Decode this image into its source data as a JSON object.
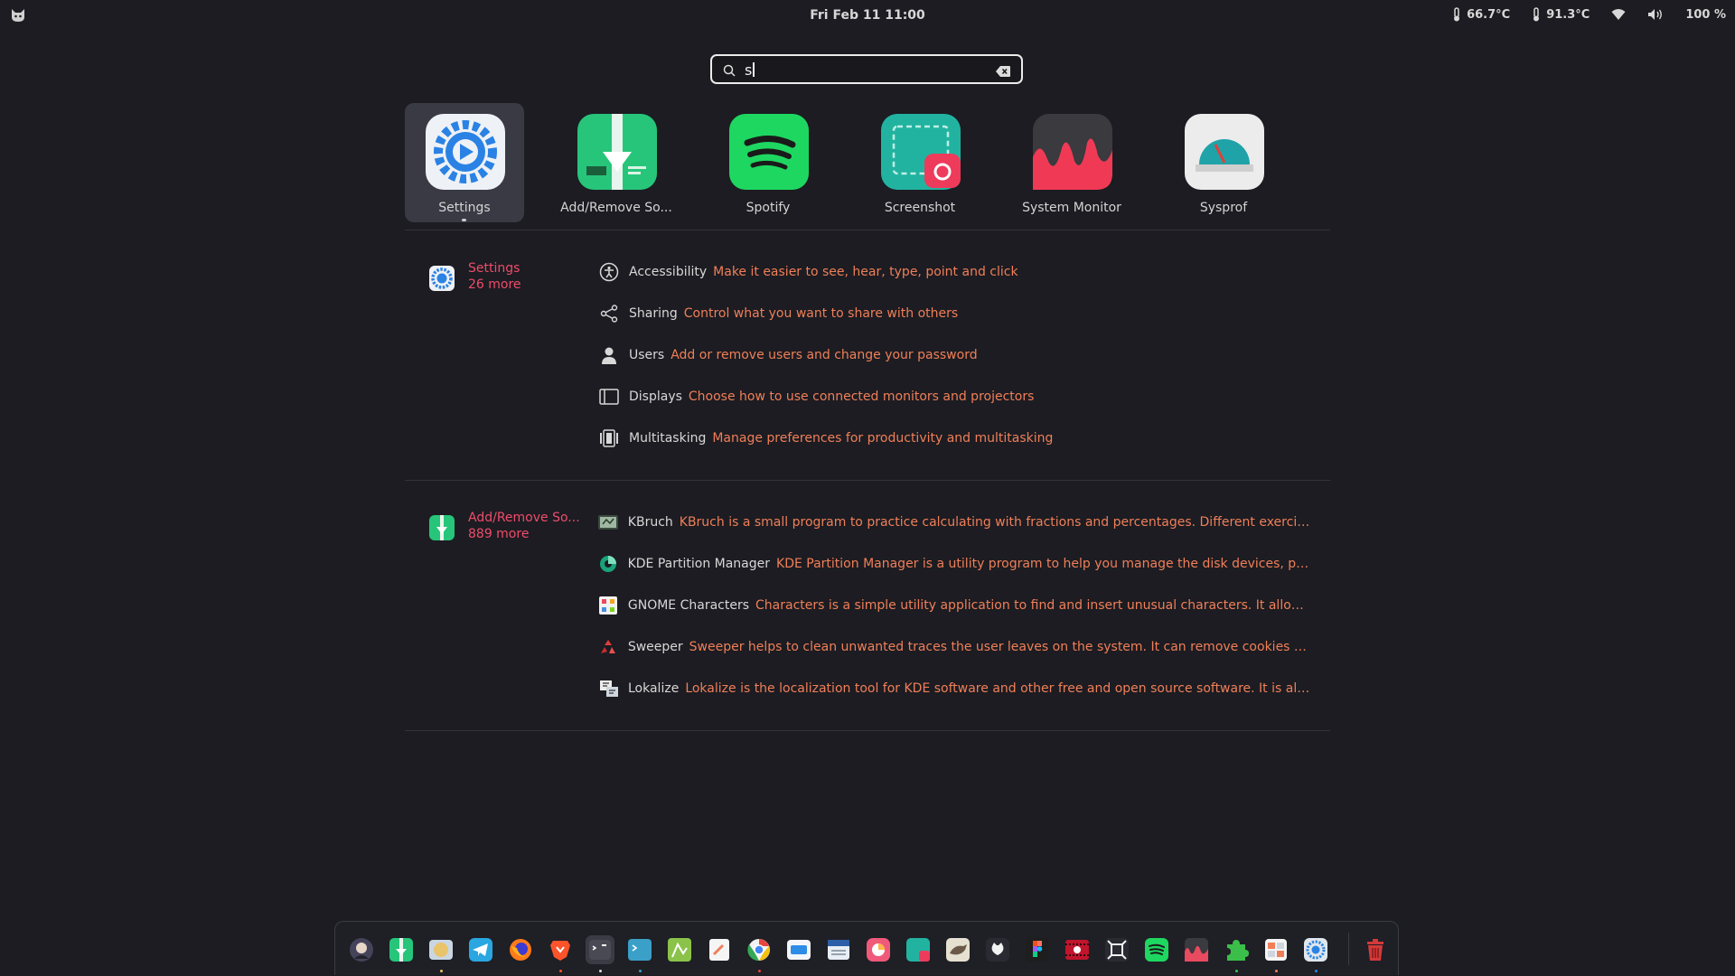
{
  "topbar": {
    "clock": "Fri Feb 11  11:00",
    "temp1": "66.7°C",
    "temp2": "91.3°C",
    "battery": "100 %"
  },
  "search": {
    "value": "s"
  },
  "apps": [
    {
      "label": "Settings",
      "icon": "settings-icon"
    },
    {
      "label": "Add/Remove So...",
      "icon": "add-remove-software-icon"
    },
    {
      "label": "Spotify",
      "icon": "spotify-icon"
    },
    {
      "label": "Screenshot",
      "icon": "screenshot-icon"
    },
    {
      "label": "System Monitor",
      "icon": "system-monitor-icon"
    },
    {
      "label": "Sysprof",
      "icon": "sysprof-icon"
    }
  ],
  "sections": [
    {
      "name": "Settings",
      "more": "26 more",
      "results": [
        {
          "title": "Accessibility",
          "desc": "Make it easier to see, hear, type, point and click",
          "icon": "accessibility-icon"
        },
        {
          "title": "Sharing",
          "desc": "Control what you want to share with others",
          "icon": "share-icon"
        },
        {
          "title": "Users",
          "desc": "Add or remove users and change your password",
          "icon": "user-icon"
        },
        {
          "title": "Displays",
          "desc": "Choose how to use connected monitors and projectors",
          "icon": "display-icon"
        },
        {
          "title": "Multitasking",
          "desc": "Manage preferences for productivity and multitasking",
          "icon": "multitasking-icon"
        }
      ]
    },
    {
      "name": "Add/Remove So...",
      "more": "889 more",
      "results": [
        {
          "title": "KBruch",
          "desc": "KBruch is a small program to practice calculating with fractions and percentages. Different exercises ar...",
          "icon": "kbruch-icon"
        },
        {
          "title": "KDE Partition Manager",
          "desc": "KDE Partition Manager is a utility program to help you manage the disk devices, partitio...",
          "icon": "partition-manager-icon"
        },
        {
          "title": "GNOME Characters",
          "desc": "Characters is a simple utility application to find and insert unusual characters. It allows yo...",
          "icon": "characters-icon"
        },
        {
          "title": "Sweeper",
          "desc": "Sweeper helps to clean unwanted traces the user leaves on the system. It can remove cookies and cl...",
          "icon": "sweeper-icon"
        },
        {
          "title": "Lokalize",
          "desc": "Lokalize is the localization tool for KDE software and other free and open source software. It is also a ...",
          "icon": "lokalize-icon"
        }
      ]
    }
  ],
  "dock": [
    {
      "name": "dock-avatar-app",
      "color": "#45435a"
    },
    {
      "name": "dock-software",
      "color": "#27c57a"
    },
    {
      "name": "dock-files",
      "color": "#e9c46a"
    },
    {
      "name": "dock-telegram",
      "color": "#2aa6e0"
    },
    {
      "name": "dock-firefox",
      "color": "#ff7a1a"
    },
    {
      "name": "dock-brave",
      "color": "#fb542b"
    },
    {
      "name": "dock-terminal",
      "color": "#4a4a55"
    },
    {
      "name": "dock-console",
      "color": "#3aa0c8"
    },
    {
      "name": "dock-drawing",
      "color": "#8bc34a"
    },
    {
      "name": "dock-text-editor",
      "color": "#f5f5f5"
    },
    {
      "name": "dock-chrome",
      "color": "#f2f2f2"
    },
    {
      "name": "dock-mail",
      "color": "#2d8ce6"
    },
    {
      "name": "dock-calendar",
      "color": "#e8eef5"
    },
    {
      "name": "dock-photos",
      "color": "#f05a7a"
    },
    {
      "name": "dock-screenshot",
      "color": "#22b3a0"
    },
    {
      "name": "dock-gimp",
      "color": "#e6e0d0"
    },
    {
      "name": "dock-github",
      "color": "#2a2a33"
    },
    {
      "name": "dock-figma",
      "color": "#1e1e1e"
    },
    {
      "name": "dock-video",
      "color": "#c0152c"
    },
    {
      "name": "dock-screen-tool",
      "color": "#2a2a33"
    },
    {
      "name": "dock-spotify",
      "color": "#1ed760"
    },
    {
      "name": "dock-system-monitor",
      "color": "#e84a5f"
    },
    {
      "name": "dock-extensions",
      "color": "#3cbf4a"
    },
    {
      "name": "dock-tweaks",
      "color": "#f5f5f5"
    },
    {
      "name": "dock-settings",
      "color": "#dfe6ee"
    },
    {
      "name": "dock-trash",
      "color": "#d23a3a"
    }
  ]
}
